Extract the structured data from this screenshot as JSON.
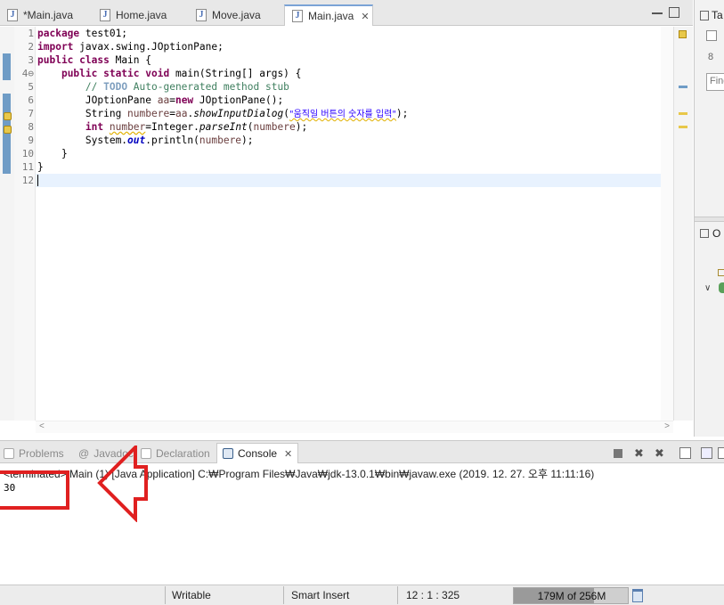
{
  "editor": {
    "tabs": [
      {
        "label": "*Main.java",
        "active": false
      },
      {
        "label": "Home.java",
        "active": false
      },
      {
        "label": "Move.java",
        "active": false
      },
      {
        "label": "Main.java",
        "active": true
      }
    ],
    "line_numbers": [
      "1",
      "2",
      "3",
      "4⊖",
      "5",
      "6",
      "7",
      "8",
      "9",
      "10",
      "11",
      "12"
    ],
    "code": {
      "l1_kw": "package",
      "l1_rest": " test01;",
      "l2_kw": "import",
      "l2_rest": " javax.swing.JOptionPane;",
      "l3_kw1": "public",
      "l3_kw2": " class",
      "l3_rest": " Main {",
      "l4_indent": "    ",
      "l4_kw": "public static void",
      "l4_rest": " main(String[] args) {",
      "l5_indent": "        ",
      "l5_comment": "// ",
      "l5_todo": "TODO",
      "l5_comment2": " Auto-generated method stub",
      "l6_indent": "        ",
      "l6_a": "JOptionPane ",
      "l6_var": "aa",
      "l6_b": "=",
      "l6_kw": "new",
      "l6_c": " JOptionPane();",
      "l7_indent": "        ",
      "l7_a": "String ",
      "l7_var": "numbere",
      "l7_b": "=",
      "l7_var2": "aa",
      "l7_c": ".",
      "l7_it": "showInputDialog",
      "l7_d": "(",
      "l7_str": "\"움직일 버튼의 숫자를 입력\"",
      "l7_e": ");",
      "l8_indent": "        ",
      "l8_kw": "int",
      "l8_a": " ",
      "l8_var": "number",
      "l8_b": "=Integer.",
      "l8_it": "parseInt",
      "l8_c": "(",
      "l8_var2": "numbere",
      "l8_d": ");",
      "l9_indent": "        ",
      "l9_a": "System.",
      "l9_fld": "out",
      "l9_b": ".println(",
      "l9_var": "numbere",
      "l9_c": ");",
      "l10": "    }",
      "l11": "}"
    },
    "hscroll_left": "<",
    "hscroll_right": ">"
  },
  "right_pane": {
    "tab1_label": "Ta",
    "find_placeholder": "Find",
    "tab2_label": "O"
  },
  "bottom": {
    "tabs": [
      {
        "label": "Problems",
        "active": false
      },
      {
        "label": "Javadoc",
        "active": false
      },
      {
        "label": "Declaration",
        "active": false
      },
      {
        "label": "Console",
        "active": true
      }
    ],
    "console_header": "<terminated> Main (1) [Java Application] C:₩Program Files₩Java₩jdk-13.0.1₩bin₩javaw.exe (2019. 12. 27. 오후 11:11:16)",
    "console_output": "30"
  },
  "status": {
    "writable": "Writable",
    "insert_mode": "Smart Insert",
    "position": "12 : 1 : 325",
    "heap": "179M of 256M",
    "heap_used_fraction": 0.7
  },
  "colors": {
    "annotation_red": "#e02020",
    "change_bar": "#6f9cc6",
    "keyword": "#7f0055"
  }
}
